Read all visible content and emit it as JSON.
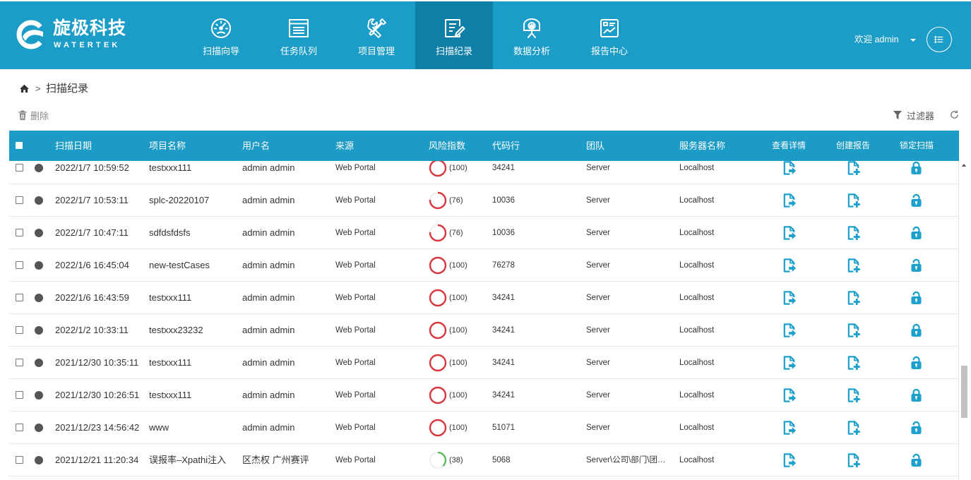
{
  "brand": {
    "name_cn": "旋极科技",
    "name_en": "WATERTEK",
    "logo_icon": "watertek-logo-icon"
  },
  "colors": {
    "nav_bg": "#1c9dc7",
    "nav_active_bg": "#0f7fa7",
    "table_header_bg": "#1b9bc6",
    "icon_accent": "#1ea0cc",
    "risk_high": "#d9363e",
    "risk_low": "#5dbb63",
    "ring_track": "#f0f0f0"
  },
  "nav": {
    "items": [
      {
        "label": "扫描向导",
        "icon": "gauge-icon",
        "active": false
      },
      {
        "label": "任务队列",
        "icon": "task-list-icon",
        "active": false
      },
      {
        "label": "项目管理",
        "icon": "tools-icon",
        "active": false
      },
      {
        "label": "扫描纪录",
        "icon": "edit-record-icon",
        "active": true
      },
      {
        "label": "数据分析",
        "icon": "chart-board-icon",
        "active": false
      },
      {
        "label": "报告中心",
        "icon": "report-board-icon",
        "active": false
      }
    ]
  },
  "user": {
    "greeting": "欢迎 admin",
    "dropdown_icon": "caret-down-icon",
    "menu_icon": "list-menu-icon"
  },
  "breadcrumb": {
    "home_icon": "home-icon",
    "separator": ">",
    "current": "扫描纪录"
  },
  "toolbar": {
    "delete_label": "删除",
    "delete_icon": "trash-icon",
    "filter_label": "过滤器",
    "filter_icon": "filter-icon",
    "refresh_icon": "refresh-icon"
  },
  "table": {
    "columns": [
      "扫描日期",
      "项目名称",
      "用户名",
      "来源",
      "风险指数",
      "代码行",
      "团队",
      "服务器名称",
      "查看详情",
      "创建报告",
      "锁定扫描"
    ],
    "rows": [
      {
        "date": "2022/1/7 10:59:52",
        "project": "testxxx111",
        "user": "admin admin",
        "source": "Web Portal",
        "risk": 100,
        "risk_label": "(100)",
        "risk_color": "#d9363e",
        "code_lines": "34241",
        "team": "Server",
        "server": "Localhost",
        "lock_icon": "lock-closed-icon"
      },
      {
        "date": "2022/1/7 10:53:11",
        "project": "splc-20220107",
        "user": "admin admin",
        "source": "Web Portal",
        "risk": 76,
        "risk_label": "(76)",
        "risk_color": "#d9363e",
        "code_lines": "10036",
        "team": "Server",
        "server": "Localhost",
        "lock_icon": "lock-open-icon"
      },
      {
        "date": "2022/1/7 10:47:11",
        "project": "sdfdsfdsfs",
        "user": "admin admin",
        "source": "Web Portal",
        "risk": 76,
        "risk_label": "(76)",
        "risk_color": "#d9363e",
        "code_lines": "10036",
        "team": "Server",
        "server": "Localhost",
        "lock_icon": "lock-open-icon"
      },
      {
        "date": "2022/1/6 16:45:04",
        "project": "new-testCases",
        "user": "admin admin",
        "source": "Web Portal",
        "risk": 100,
        "risk_label": "(100)",
        "risk_color": "#d9363e",
        "code_lines": "76278",
        "team": "Server",
        "server": "Localhost",
        "lock_icon": "lock-open-icon"
      },
      {
        "date": "2022/1/6 16:43:59",
        "project": "testxxx111",
        "user": "admin admin",
        "source": "Web Portal",
        "risk": 100,
        "risk_label": "(100)",
        "risk_color": "#d9363e",
        "code_lines": "34241",
        "team": "Server",
        "server": "Localhost",
        "lock_icon": "lock-open-icon"
      },
      {
        "date": "2022/1/2 10:33:11",
        "project": "testxxx23232",
        "user": "admin admin",
        "source": "Web Portal",
        "risk": 100,
        "risk_label": "(100)",
        "risk_color": "#d9363e",
        "code_lines": "34241",
        "team": "Server",
        "server": "Localhost",
        "lock_icon": "lock-closed-icon"
      },
      {
        "date": "2021/12/30 10:35:11",
        "project": "testxxx111",
        "user": "admin admin",
        "source": "Web Portal",
        "risk": 100,
        "risk_label": "(100)",
        "risk_color": "#d9363e",
        "code_lines": "34241",
        "team": "Server",
        "server": "Localhost",
        "lock_icon": "lock-open-icon"
      },
      {
        "date": "2021/12/30 10:26:51",
        "project": "testxxx111",
        "user": "admin admin",
        "source": "Web Portal",
        "risk": 100,
        "risk_label": "(100)",
        "risk_color": "#d9363e",
        "code_lines": "34241",
        "team": "Server",
        "server": "Localhost",
        "lock_icon": "lock-closed-icon"
      },
      {
        "date": "2021/12/23 14:56:42",
        "project": "www",
        "user": "admin admin",
        "source": "Web Portal",
        "risk": 100,
        "risk_label": "(100)",
        "risk_color": "#d9363e",
        "code_lines": "51071",
        "team": "Server",
        "server": "Localhost",
        "lock_icon": "lock-open-icon"
      },
      {
        "date": "2021/12/21 11:20:34",
        "project": "误报率–Xpathi注入",
        "user": "区杰权 广州赛评",
        "source": "Web Portal",
        "risk": 38,
        "risk_label": "(38)",
        "risk_color": "#5dbb63",
        "code_lines": "5068",
        "team": "Server\\公司\\部门\\团…",
        "server": "Localhost",
        "lock_icon": "lock-open-icon"
      }
    ]
  }
}
